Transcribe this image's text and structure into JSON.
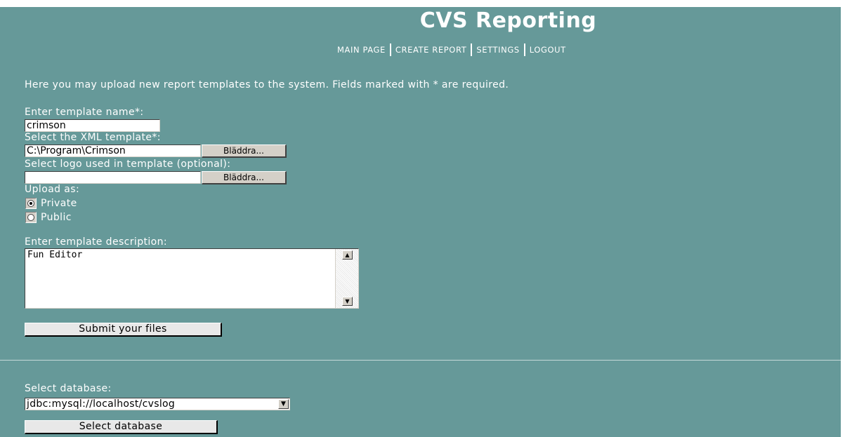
{
  "header": {
    "title": "CVS Reporting",
    "nav": [
      "MAIN PAGE",
      "CREATE REPORT",
      "SETTINGS",
      "LOGOUT"
    ]
  },
  "upload": {
    "intro": "Here you may upload new report templates to the system. Fields marked with * are required.",
    "template_name_label": "Enter template name*:",
    "template_name_value": "crimson",
    "xml_label": "Select the XML template*:",
    "xml_value": "C:\\Program\\Crimson",
    "browse_label": "Bläddra...",
    "logo_label": "Select logo used in template (optional):",
    "logo_value": "",
    "upload_as_label": "Upload as:",
    "options": [
      {
        "label": "Private",
        "selected": true
      },
      {
        "label": "Public",
        "selected": false
      }
    ],
    "description_label": "Enter template description:",
    "description_value": "Fun Editor",
    "submit_label": "Submit your files"
  },
  "database": {
    "label": "Select database:",
    "selected": "jdbc:mysql://localhost/cvslog",
    "button_label": "Select database"
  },
  "colors": {
    "background": "#669999",
    "text": "#ffffff"
  }
}
